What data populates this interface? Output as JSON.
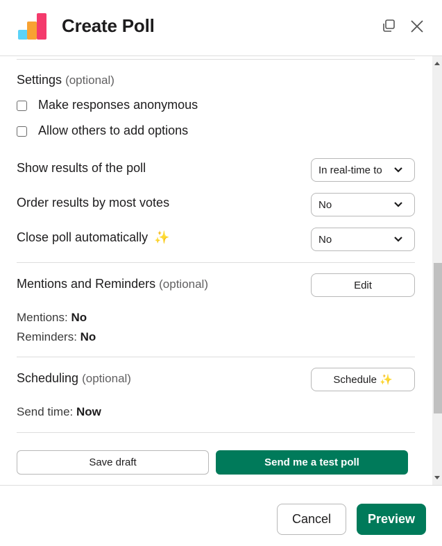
{
  "header": {
    "title": "Create Poll",
    "logo_icon": "bar-chart-logo",
    "expand_icon": "open-in-window-icon",
    "close_icon": "close-icon",
    "logo_colors": [
      "#5bd3f8",
      "#f8a232",
      "#f43a6c"
    ]
  },
  "settings": {
    "title": "Settings",
    "optional": "(optional)",
    "checkboxes": [
      {
        "label": "Make responses anonymous",
        "checked": false
      },
      {
        "label": "Allow others to add options",
        "checked": false
      }
    ],
    "rows": [
      {
        "label": "Show results of the poll",
        "value": "In real-time to"
      },
      {
        "label": "Order results by most votes",
        "value": "No"
      },
      {
        "label": "Close poll automatically",
        "sparkle": "✨",
        "value": "No"
      }
    ]
  },
  "mentions": {
    "title": "Mentions and Reminders",
    "optional": "(optional)",
    "edit_label": "Edit",
    "items": [
      {
        "key": "Mentions:",
        "value": "No"
      },
      {
        "key": "Reminders:",
        "value": "No"
      }
    ]
  },
  "scheduling": {
    "title": "Scheduling",
    "optional": "(optional)",
    "schedule_label": "Schedule",
    "sparkle": "✨",
    "send_time_key": "Send time:",
    "send_time_value": "Now"
  },
  "actions": {
    "save_draft": "Save draft",
    "send_test": "Send me a test poll"
  },
  "footer": {
    "cancel": "Cancel",
    "preview": "Preview"
  },
  "colors": {
    "primary": "#007a5a",
    "border": "#dddddd"
  }
}
